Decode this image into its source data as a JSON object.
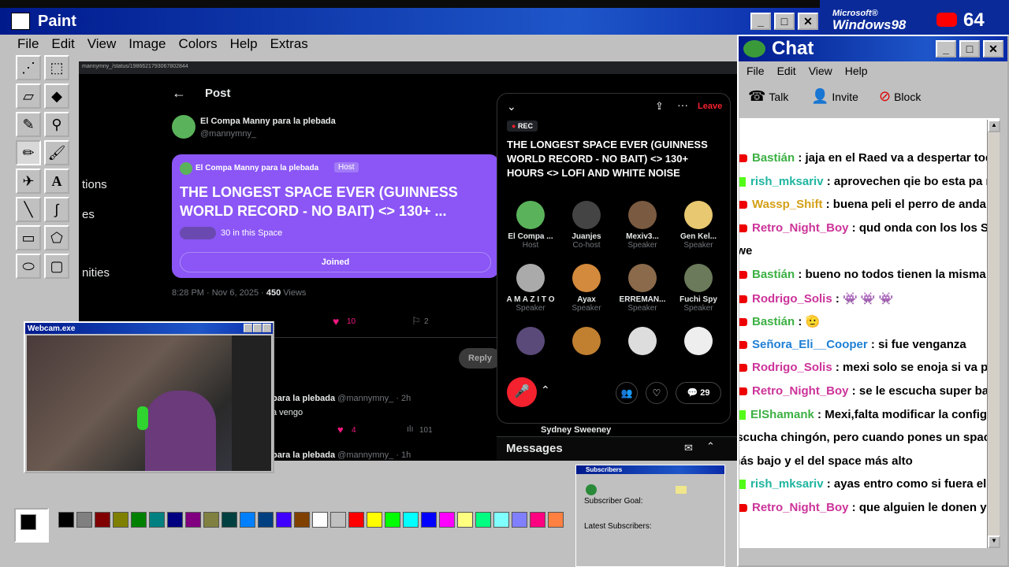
{
  "paint": {
    "title": "Paint",
    "menu": [
      "File",
      "Edit",
      "View",
      "Image",
      "Colors",
      "Help",
      "Extras"
    ]
  },
  "win98": {
    "logo_small": "Microsoft®",
    "logo": "Windows98",
    "yt_count": "64"
  },
  "tweet": {
    "url": "mannymny_/status/1986621793067802844",
    "header": "Post",
    "author": "El Compa Manny para la plebada",
    "handle": "@mannymny_",
    "card_author": "El Compa Manny para la plebada",
    "card_badge": "Host",
    "card_title": "THE LONGEST SPACE EVER (GUINNESS WORLD RECORD - NO BAIT) <> 130+ ...",
    "card_count": "30 in this Space",
    "joined": "Joined",
    "meta_time": "8:28 PM · Nov 6, 2025 · ",
    "meta_views": "450",
    "meta_views_label": " Views",
    "likes": "10",
    "bookmarks": "2",
    "reply_btn": "Reply",
    "reply_author": "para la plebada",
    "reply_handle": "@mannymny_ · 2h",
    "reply_text": "a vengo",
    "reply_likes": "4",
    "reply_views": "101",
    "reply2_author": "para la plebada",
    "reply2_handle": "@mannymny_ · 1h",
    "side_items": [
      "tions",
      "es",
      "nities"
    ],
    "trend_name": "Sydney Sweeney",
    "messages": "Messages"
  },
  "space": {
    "leave": "Leave",
    "rec": "REC",
    "title": "THE LONGEST SPACE EVER (GUINNESS WORLD RECORD - NO BAIT) <> 130+ HOURS <> LOFI AND WHITE NOISE",
    "speakers": [
      {
        "name": "El Compa ...",
        "role": "Host",
        "color": "#5ab35a"
      },
      {
        "name": "Juanjes",
        "role": "Co-host",
        "color": "#444"
      },
      {
        "name": "Mexiv3...",
        "role": "Speaker",
        "color": "#7a5a40"
      },
      {
        "name": "Gen Kel...",
        "role": "Speaker",
        "color": "#e8c870"
      },
      {
        "name": "A M A Z I T O",
        "role": "Speaker",
        "color": "#aaa"
      },
      {
        "name": "Ayax",
        "role": "Speaker",
        "color": "#d48a3c"
      },
      {
        "name": "ERREMAN...",
        "role": "Speaker",
        "color": "#8a6a4a"
      },
      {
        "name": "Fuchi Spy",
        "role": "Speaker",
        "color": "#6a7a5a"
      },
      {
        "name": "",
        "role": "",
        "color": "#5a4a7a"
      },
      {
        "name": "",
        "role": "",
        "color": "#c08030"
      },
      {
        "name": "",
        "role": "",
        "color": "#ddd"
      },
      {
        "name": "",
        "role": "",
        "color": "#eee"
      }
    ],
    "comments": "29"
  },
  "webcam": {
    "title": "Webcam.exe"
  },
  "subs": {
    "title": "Subscribers",
    "goal": "Subscriber Goal:",
    "latest": "Latest Subscribers:"
  },
  "chat": {
    "title": "Chat",
    "menu": [
      "File",
      "Edit",
      "View",
      "Help"
    ],
    "toolbar": {
      "talk": "Talk",
      "invite": "Invite",
      "block": "Block"
    },
    "messages": [
      {
        "user": "Bastián",
        "color": "#3cb043",
        "text": " : jaja en el Raed va a despertar todo en",
        "src": "yt"
      },
      {
        "user": "rish_mksariv",
        "color": "#1fb5a0",
        "text": " : aprovechen qie bo esta pa rajar",
        "src": "kick"
      },
      {
        "user": "Wassp_Shift",
        "color": "#d4a017",
        "text": " : buena peli el perro de andaluz",
        "src": "yt"
      },
      {
        "user": "Retro_Night_Boy",
        "color": "#cc3399",
        "text": " : qud onda con los los Squid",
        "src": "yt"
      },
      {
        "user": "",
        "color": "#000",
        "text": "ewe",
        "src": "cont"
      },
      {
        "user": "Bastián",
        "color": "#3cb043",
        "text": " : bueno no todos tienen la misma reac",
        "src": "yt"
      },
      {
        "user": "Rodrigo_Solis",
        "color": "#cc3399",
        "text": " : 👾  👾  👾",
        "src": "yt"
      },
      {
        "user": "Bastián",
        "color": "#3cb043",
        "text": " : 🫡",
        "src": "yt"
      },
      {
        "user": "Señora_Eli__Cooper",
        "color": "#1e7fd4",
        "text": " : si fue venganza",
        "src": "yt"
      },
      {
        "user": "Rodrigo_Solis",
        "color": "#cc3399",
        "text": " : mexi solo se enoja si va perdie",
        "src": "yt"
      },
      {
        "user": "Retro_Night_Boy",
        "color": "#cc3399",
        "text": " : se le escucha super bajo al",
        "src": "yt"
      },
      {
        "user": "ElShamank",
        "color": "#3cb043",
        "text": " : Mexi,falta modificar la configura",
        "src": "kick"
      },
      {
        "user": "",
        "color": "#000",
        "text": "escucha chingón, pero cuando pones un space en",
        "src": "cont"
      },
      {
        "user": "",
        "color": "#000",
        "text": "más bajo y el del space más alto",
        "src": "cont"
      },
      {
        "user": "rish_mksariv",
        "color": "#1fb5a0",
        "text": " : ayas entro como si fuera el galle",
        "src": "kick"
      },
      {
        "user": "Retro_Night_Boy",
        "color": "#cc3399",
        "text": " : que alguien le donen y le dio",
        "src": "yt"
      }
    ]
  },
  "palette": [
    "#000000",
    "#808080",
    "#800000",
    "#808000",
    "#008000",
    "#008080",
    "#000080",
    "#800080",
    "#808040",
    "#004040",
    "#0080ff",
    "#004080",
    "#4000ff",
    "#804000",
    "#ffffff",
    "#c0c0c0",
    "#ff0000",
    "#ffff00",
    "#00ff00",
    "#00ffff",
    "#0000ff",
    "#ff00ff",
    "#ffff80",
    "#00ff80",
    "#80ffff",
    "#8080ff",
    "#ff0080",
    "#ff8040"
  ]
}
